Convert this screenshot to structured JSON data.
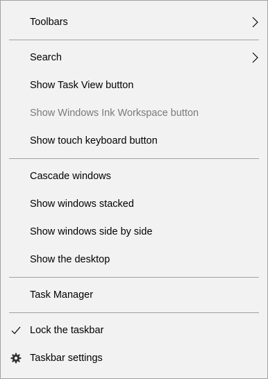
{
  "menu": {
    "toolbars": "Toolbars",
    "search": "Search",
    "show_task_view": "Show Task View button",
    "show_ink_workspace": "Show Windows Ink Workspace button",
    "show_touch_keyboard": "Show touch keyboard button",
    "cascade_windows": "Cascade windows",
    "show_stacked": "Show windows stacked",
    "show_side_by_side": "Show windows side by side",
    "show_desktop": "Show the desktop",
    "task_manager": "Task Manager",
    "lock_taskbar": "Lock the taskbar",
    "taskbar_settings": "Taskbar settings"
  },
  "state": {
    "lock_taskbar_checked": true,
    "ink_workspace_enabled": false
  },
  "icons": {
    "submenu": "chevron-right-icon",
    "check": "checkmark-icon",
    "settings": "gear-icon"
  },
  "colors": {
    "background": "#f2f2f2",
    "border": "#a0a0a0",
    "text": "#000000",
    "disabled_text": "#7a7a7a"
  }
}
